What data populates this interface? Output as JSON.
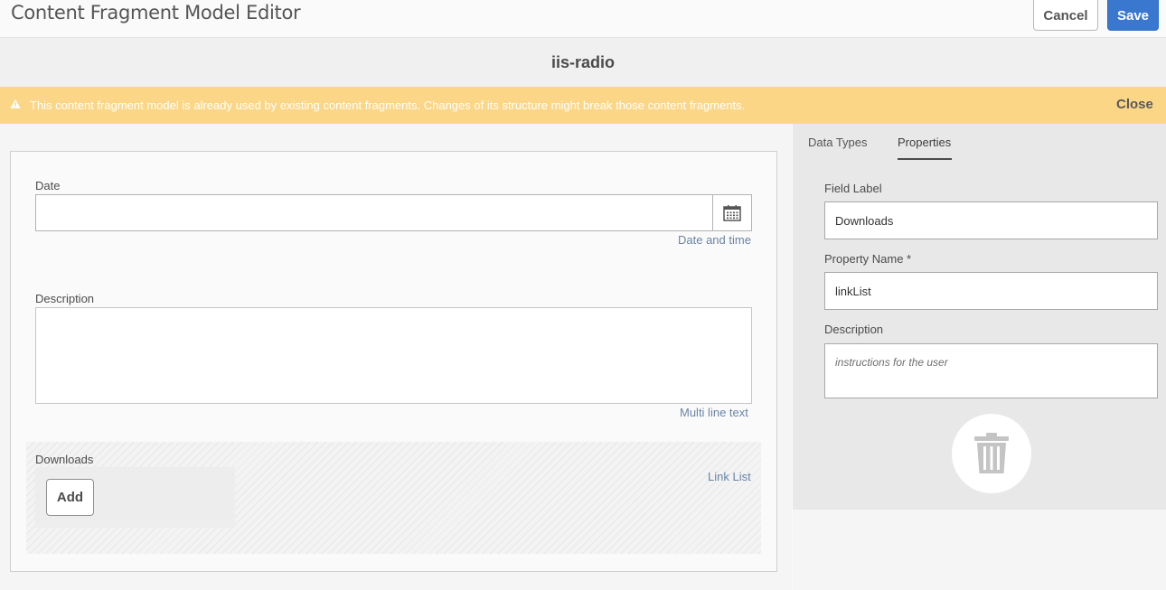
{
  "header": {
    "title": "Content Fragment Model Editor",
    "cancel_label": "Cancel",
    "save_label": "Save"
  },
  "model": {
    "name": "iis-radio"
  },
  "warning": {
    "message": "This content fragment model is already used by existing content fragments. Changes of its structure might break those content fragments.",
    "close_label": "Close",
    "icon": "warning-triangle-icon"
  },
  "canvas": {
    "fields": [
      {
        "label": "Date",
        "type_hint": "Date and time",
        "value": "",
        "icon": "calendar-icon"
      },
      {
        "label": "Description",
        "type_hint": "Multi line text",
        "value": ""
      },
      {
        "label": "Downloads",
        "type_hint": "Link List",
        "add_label": "Add"
      }
    ]
  },
  "panel": {
    "tabs": [
      {
        "label": "Data Types",
        "active": false
      },
      {
        "label": "Properties",
        "active": true
      }
    ],
    "field_label_label": "Field Label",
    "field_label_value": "Downloads",
    "property_name_label": "Property Name *",
    "property_name_value": "linkList",
    "description_label": "Description",
    "description_placeholder": "instructions for the user",
    "delete_icon": "trash-icon"
  },
  "colors": {
    "accent": "#3a78d0",
    "warning": "#fbd686",
    "hint_link": "#6a84a6"
  }
}
